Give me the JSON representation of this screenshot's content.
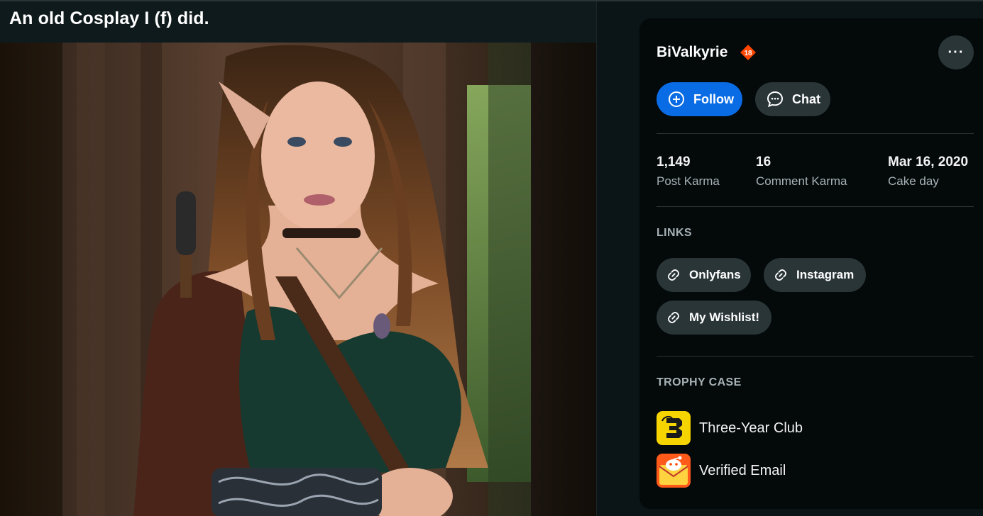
{
  "post": {
    "title": "An old Cosplay I (f) did."
  },
  "profile": {
    "username": "BiValkyrie",
    "nsfw_badge": "18",
    "more_label": "···",
    "follow_label": "Follow",
    "chat_label": "Chat",
    "stats": [
      {
        "value": "1,149",
        "label": "Post Karma"
      },
      {
        "value": "16",
        "label": "Comment Karma"
      },
      {
        "value": "Mar 16, 2020",
        "label": "Cake day"
      }
    ],
    "links_title": "LINKS",
    "links": [
      {
        "label": "Onlyfans"
      },
      {
        "label": "Instagram"
      },
      {
        "label": "My Wishlist!"
      }
    ],
    "trophy_title": "TROPHY CASE",
    "trophies": [
      {
        "label": "Three-Year Club",
        "icon": "three-year-club-icon"
      },
      {
        "label": "Verified Email",
        "icon": "verified-email-icon"
      }
    ]
  },
  "colors": {
    "follow_blue": "#0a6ce5",
    "chip_bg": "#2a3538",
    "card_bg": "#04090a",
    "page_bg": "#0b1416",
    "nsfw_orange": "#ff4500"
  }
}
